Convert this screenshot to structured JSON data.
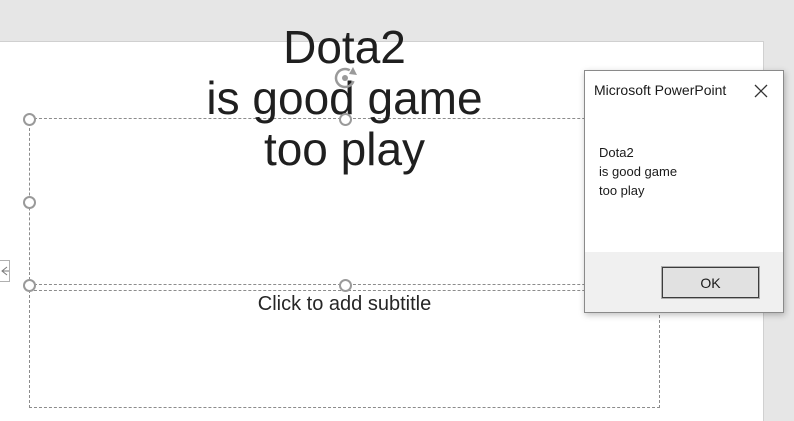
{
  "slide": {
    "title_lines": [
      "Dota2",
      "is good game",
      "too play"
    ],
    "subtitle_placeholder": "Click to add subtitle"
  },
  "dialog": {
    "title": "Microsoft PowerPoint",
    "message_lines": [
      "Dota2",
      "is good game",
      "too play"
    ],
    "ok_label": "OK",
    "close_icon": "close-icon"
  }
}
